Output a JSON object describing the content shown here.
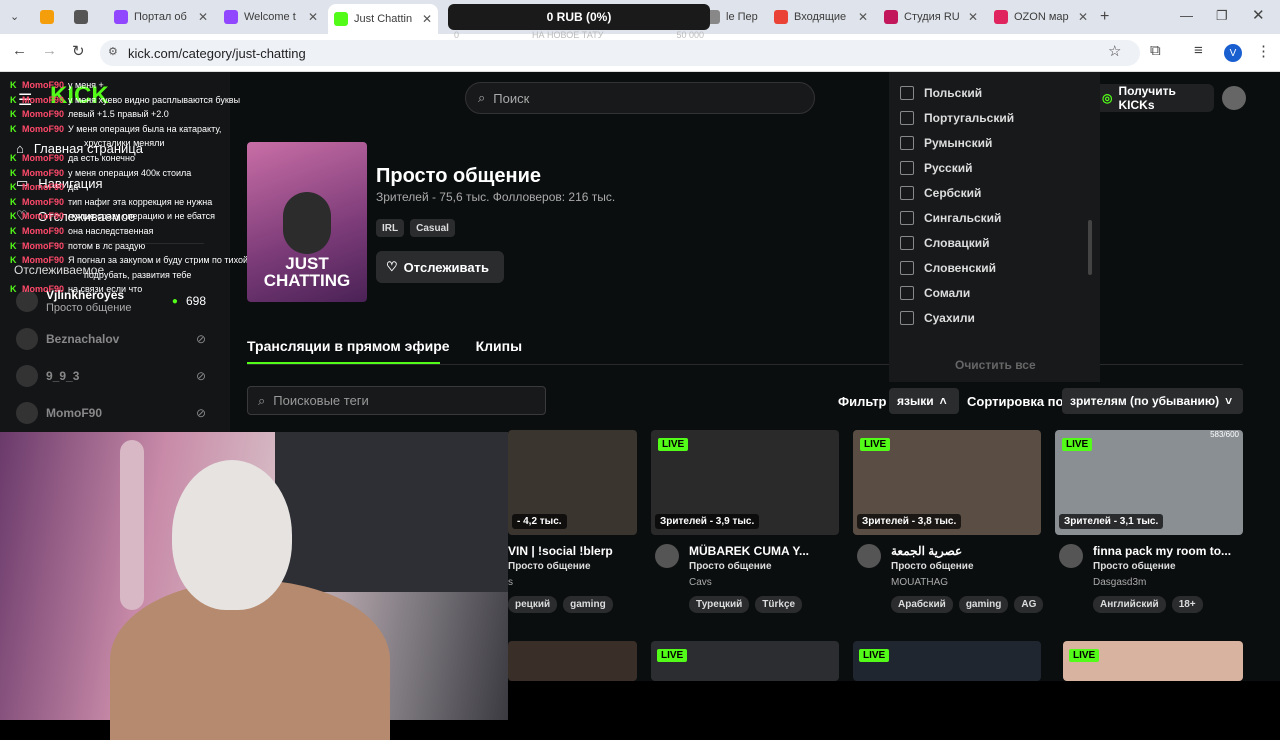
{
  "browser": {
    "tabs": [
      {
        "label": "",
        "color": "#f59e0b"
      },
      {
        "label": "",
        "color": "#555"
      },
      {
        "label": "Портал об",
        "color": "#9146ff"
      },
      {
        "label": "Welcome t",
        "color": "#9146ff"
      },
      {
        "label": "Just Chattin",
        "color": "#53fc18"
      },
      {
        "label": "le Пер",
        "color": "#888"
      },
      {
        "label": "Входящие",
        "color": "#ea4335"
      },
      {
        "label": "Студия RU",
        "color": "#c2185b"
      },
      {
        "label": "OZON мар",
        "color": "#e0245e"
      }
    ],
    "url": "kick.com/category/just-chatting",
    "profile_initial": "V"
  },
  "donation": {
    "amount": "0 RUB (0%)",
    "goal": "НА НОВОЕ ТАТУ",
    "left": "0",
    "right": "50 000"
  },
  "sidebar": {
    "nav": [
      "Главная страница",
      "Навигация",
      "Отслеживаемое"
    ],
    "section": "Отслеживаемое",
    "follows": [
      {
        "name": "Vjlinkheroyes",
        "sub": "Просто общение",
        "viewers": "698"
      },
      {
        "name": "Beznachalov"
      },
      {
        "name": "9_9_3"
      },
      {
        "name": "MomoF90"
      }
    ]
  },
  "chat": [
    {
      "u": "MomoF90",
      "m": "у меня +"
    },
    {
      "u": "MomoF90",
      "m": "у меня хуево видно расплываются буквы"
    },
    {
      "u": "MomoF90",
      "m": "левый +1.5 правый +2.0"
    },
    {
      "u": "MomoF90",
      "m": "У меня операция была на катаракту,"
    },
    {
      "u": "",
      "m": "хрусталики меняли"
    },
    {
      "u": "MomoF90",
      "m": "да есть конечно"
    },
    {
      "u": "MomoF90",
      "m": "у меня операция 400к стоила"
    },
    {
      "u": "MomoF90",
      "m": "да"
    },
    {
      "u": "MomoF90",
      "m": "тип нафиг эта коррекция не нужна"
    },
    {
      "u": "MomoF90",
      "m": "лучше сразу операцию и не ебатся"
    },
    {
      "u": "MomoF90",
      "m": "она наследственная"
    },
    {
      "u": "MomoF90",
      "m": "потом в лс раздую"
    },
    {
      "u": "MomoF90",
      "m": "Я погнал за закупом и буду стрим по тихой"
    },
    {
      "u": "",
      "m": "подрубать, развития тебе"
    },
    {
      "u": "MomoF90",
      "m": "на связи если что"
    }
  ],
  "header": {
    "search_placeholder": "Поиск",
    "get_kicks": "Получить KICKs"
  },
  "category": {
    "title": "Просто общение",
    "stats": "Зрителей - 75,6 тыс.   Фолловеров: 216 тыс.",
    "tags": [
      "IRL",
      "Casual"
    ],
    "follow": "Отслеживать",
    "cover_text": "JUST CHATTING"
  },
  "tabs": {
    "live": "Трансляции в прямом эфире",
    "clips": "Клипы"
  },
  "filters": {
    "tag_search": "Поисковые теги",
    "filter_label": "Фильтр",
    "languages": "языки",
    "sort_label": "Сортировка по",
    "sort_value": "зрителям (по убыванию)"
  },
  "language_dropdown": {
    "items": [
      "Польский",
      "Португальский",
      "Румынский",
      "Русский",
      "Сербский",
      "Сингальский",
      "Словацкий",
      "Словенский",
      "Сомали",
      "Суахили"
    ],
    "clear": "Очистить все"
  },
  "streams": [
    {
      "title": "VIN | !social !blerp",
      "viewers": "- 4,2 тыс.",
      "cat": "Просто общение",
      "name": "s",
      "tags": [
        "рецкий",
        "gaming"
      ],
      "color": "#3b3530"
    },
    {
      "title": "MÜBAREK CUMA Y...",
      "viewers": "Зрителей - 3,9 тыс.",
      "cat": "Просто общение",
      "name": "Cavs",
      "tags": [
        "Турецкий",
        "Türkçe"
      ],
      "color": "#2a2a2a",
      "live": "LIVE"
    },
    {
      "title": "عصرية الجمعة",
      "viewers": "Зрителей - 3,8 тыс.",
      "cat": "Просто общение",
      "name": "MOUATHAG",
      "tags": [
        "Арабский",
        "gaming",
        "AG"
      ],
      "color": "#5a4e44",
      "live": "LIVE"
    },
    {
      "title": "finna pack my room to...",
      "viewers": "Зрителей - 3,1 тыс.",
      "cat": "Просто общение",
      "name": "Dasgasd3m",
      "tags": [
        "Английский",
        "18+"
      ],
      "color": "#8a8f94",
      "live": "LIVE",
      "count": "583/600"
    }
  ],
  "row2_live": [
    "LIVE",
    "LIVE",
    "LIVE"
  ]
}
